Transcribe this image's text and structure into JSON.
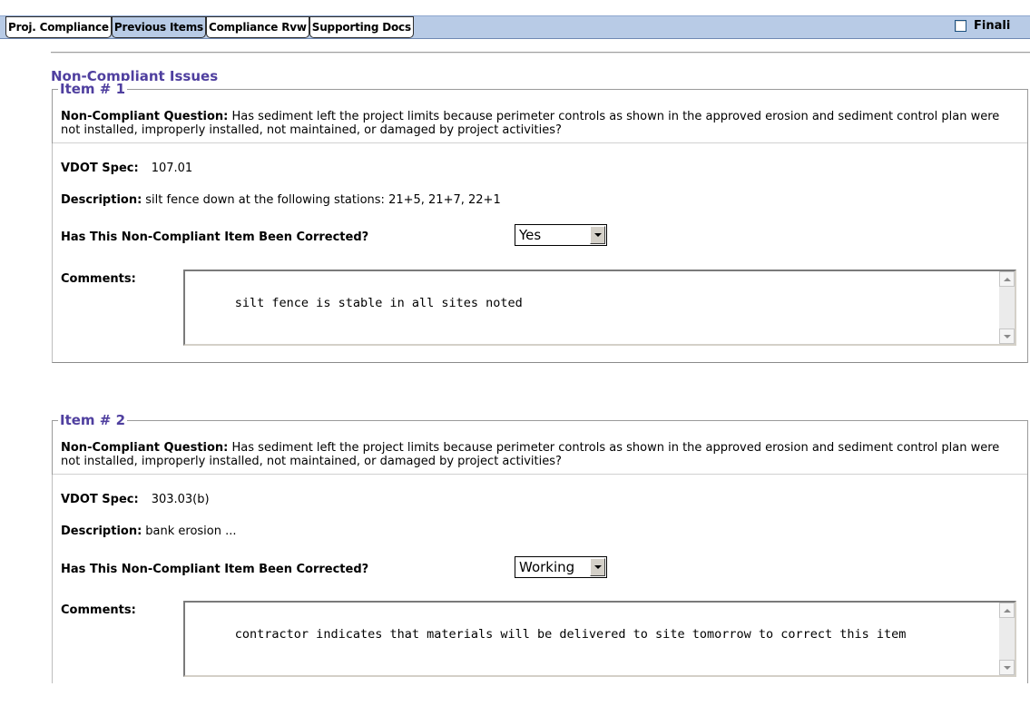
{
  "tabs": [
    {
      "label": "Proj. Compliance",
      "active": false
    },
    {
      "label": "Previous Items",
      "active": true
    },
    {
      "label": "Compliance Rvw",
      "active": false
    },
    {
      "label": "Supporting Docs",
      "active": false
    }
  ],
  "finalize": {
    "label": "Finali",
    "checked": false
  },
  "section": {
    "title": "Non-Compliant Issues"
  },
  "items": [
    {
      "legend": "Item # 1",
      "question_label": "Non-Compliant Question:",
      "question_text": " Has sediment left the project limits because perimeter controls as shown in the approved erosion and sediment control plan were not installed, improperly installed, not maintained, or damaged by project activities?",
      "spec_label": "VDOT Spec:",
      "spec_value": "107.01",
      "desc_label": "Description:",
      "desc_value": "silt fence down at the following stations: 21+5, 21+7, 22+1",
      "corrected_label": "Has This Non-Compliant Item Been Corrected?",
      "corrected_value": "Yes",
      "comments_label": "Comments:",
      "comments_value": "silt fence is stable in all sites noted"
    },
    {
      "legend": "Item # 2",
      "question_label": "Non-Compliant Question:",
      "question_text": " Has sediment left the project limits because perimeter controls as shown in the approved erosion and sediment control plan were not installed, improperly installed, not maintained, or damaged by project activities?",
      "spec_label": "VDOT Spec:",
      "spec_value": "303.03(b)",
      "desc_label": "Description:",
      "desc_value": "bank erosion ...",
      "corrected_label": "Has This Non-Compliant Item Been Corrected?",
      "corrected_value": "Working",
      "comments_label": "Comments:",
      "comments_value": "contractor indicates that materials will be delivered to site tomorrow to correct this item"
    }
  ],
  "icons": {
    "dropdown": "chevron-down-icon",
    "scroll_up": "scroll-up-arrow-icon",
    "scroll_down": "scroll-down-arrow-icon"
  },
  "colors": {
    "tab_band": "#b8cbe6",
    "heading": "#4f3f9f"
  }
}
